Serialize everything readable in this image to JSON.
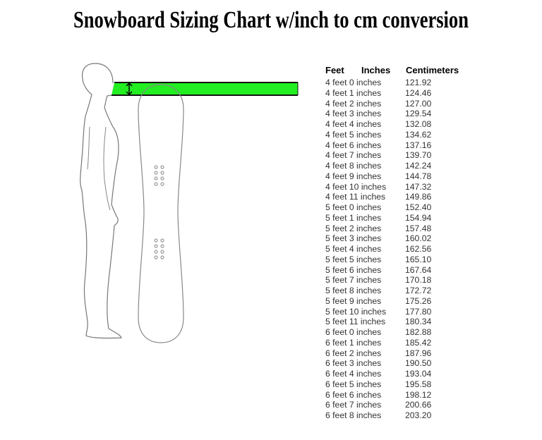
{
  "title": "Snowboard Sizing Chart w/inch to cm conversion",
  "figure": {
    "description": "Outline of a person standing beside a snowboard; green band marks the range from chin to nose height where the board tip should reach",
    "highlight_color": "#22ee22"
  },
  "table": {
    "headers": {
      "feet": "Feet",
      "inches": "Inches",
      "cm": "Centimeters"
    },
    "rows": [
      {
        "height": "4 feet 0 inches",
        "cm": "121.92"
      },
      {
        "height": "4 feet 1 inches",
        "cm": "124.46"
      },
      {
        "height": "4 feet 2 inches",
        "cm": "127.00"
      },
      {
        "height": "4 feet 3 inches",
        "cm": "129.54"
      },
      {
        "height": "4 feet 4 inches",
        "cm": "132.08"
      },
      {
        "height": "4 feet 5 inches",
        "cm": "134.62"
      },
      {
        "height": "4 feet 6 inches",
        "cm": "137.16"
      },
      {
        "height": "4 feet 7 inches",
        "cm": "139.70"
      },
      {
        "height": "4 feet 8 inches",
        "cm": "142.24"
      },
      {
        "height": "4 feet 9 inches",
        "cm": "144.78"
      },
      {
        "height": "4 feet 10 inches",
        "cm": "147.32"
      },
      {
        "height": "4 feet 11 inches",
        "cm": "149.86"
      },
      {
        "height": "5 feet 0 inches",
        "cm": "152.40"
      },
      {
        "height": "5 feet 1 inches",
        "cm": "154.94"
      },
      {
        "height": "5 feet 2 inches",
        "cm": "157.48"
      },
      {
        "height": "5 feet 3 inches",
        "cm": "160.02"
      },
      {
        "height": "5 feet 4 inches",
        "cm": "162.56"
      },
      {
        "height": "5 feet 5 inches",
        "cm": "165.10"
      },
      {
        "height": "5 feet 6 inches",
        "cm": "167.64"
      },
      {
        "height": "5 feet 7 inches",
        "cm": "170.18"
      },
      {
        "height": "5 feet 8 inches",
        "cm": "172.72"
      },
      {
        "height": "5 feet 9 inches",
        "cm": "175.26"
      },
      {
        "height": "5 feet 10 inches",
        "cm": "177.80"
      },
      {
        "height": "5 feet 11 inches",
        "cm": "180.34"
      },
      {
        "height": "6 feet 0 inches",
        "cm": "182.88"
      },
      {
        "height": "6 feet 1 inches",
        "cm": "185.42"
      },
      {
        "height": "6 feet 2 inches",
        "cm": "187.96"
      },
      {
        "height": "6 feet 3 inches",
        "cm": "190.50"
      },
      {
        "height": "6 feet 4 inches",
        "cm": "193.04"
      },
      {
        "height": "6 feet 5 inches",
        "cm": "195.58"
      },
      {
        "height": "6 feet 6 inches",
        "cm": "198.12"
      },
      {
        "height": "6 feet 7 inches",
        "cm": "200.66"
      },
      {
        "height": "6 feet 8 inches",
        "cm": "203.20"
      }
    ]
  }
}
